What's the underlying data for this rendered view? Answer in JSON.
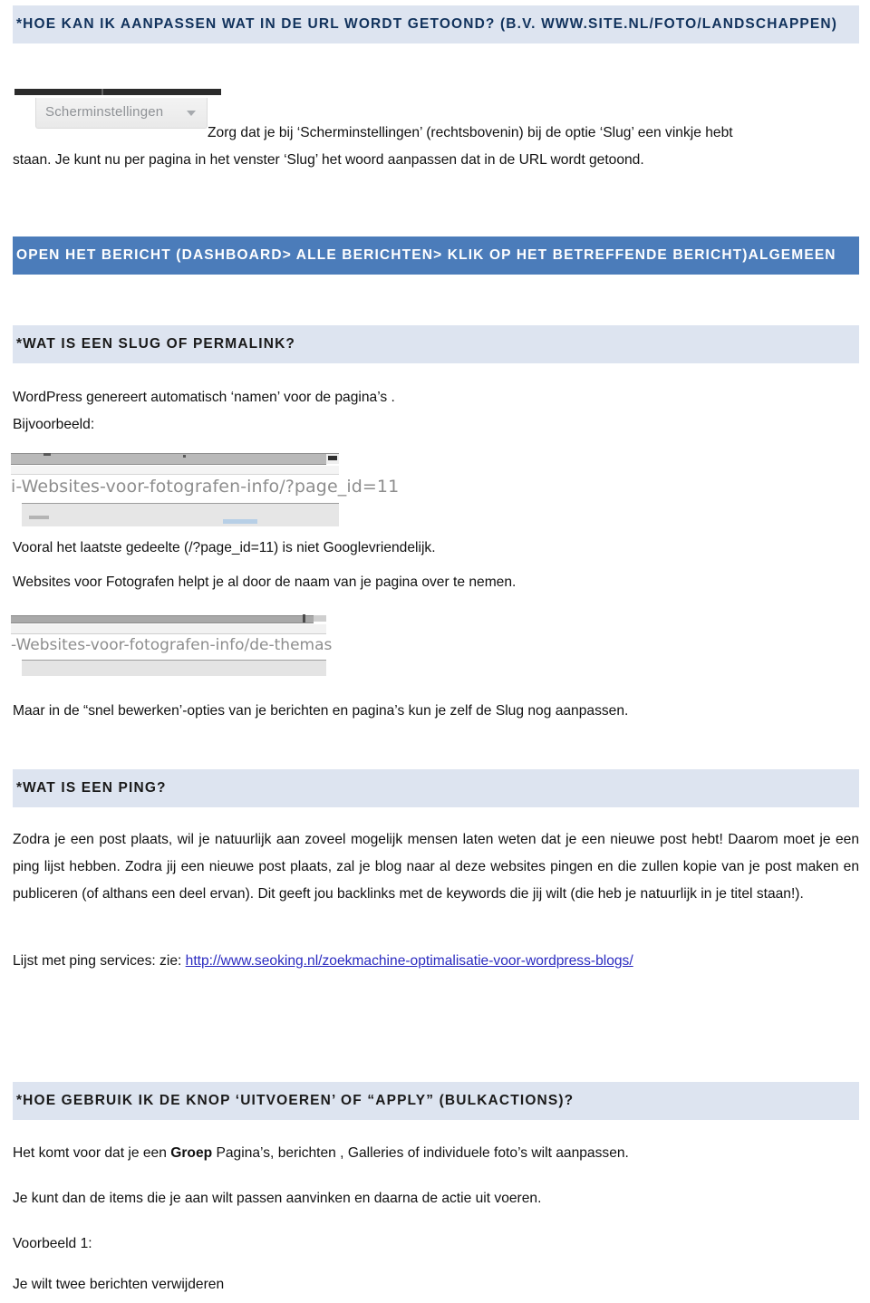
{
  "document": {
    "language": "nl",
    "colors": {
      "band_light": "#dde4f0",
      "band_blue": "#4b7cba",
      "link": "#2a2ac0",
      "text": "#111111"
    }
  },
  "sections": [
    {
      "id": "url-aanpassen",
      "heading": "*HOE KAN IK AANPASSEN WAT IN DE URL WORDT GETOOND? (B.V. WWW.SITE.NL/FOTO/LANDSCHAPPEN)",
      "style": "light"
    },
    {
      "id": "open-het-bericht",
      "heading": "OPEN HET BERICHT (DASHBOARD> ALLE BERICHTEN> KLIK OP HET BETREFFENDE BERICHT)ALGEMEEN",
      "style": "blue"
    },
    {
      "id": "wat-is-een-slug",
      "heading": "*WAT IS EEN SLUG OF PERMALINK?",
      "style": "light"
    },
    {
      "id": "wat-is-een-ping",
      "heading": "*WAT IS EEN PING?",
      "style": "light"
    },
    {
      "id": "knop-uitvoeren",
      "heading": "*HOE GEBRUIK IK DE KNOP ‘UITVOEREN’ OF “APPLY” (BULKACTIONS)?",
      "style": "light"
    }
  ],
  "body": {
    "scherm_intro_line1": "Zorg dat je bij ‘Scherminstellingen’ (rechtsbovenin) bij de optie ‘Slug’ een vinkje hebt",
    "scherm_intro_line2": "staan. Je kunt nu per pagina in het venster ‘Slug’ het woord aanpassen dat in de URL wordt getoond.",
    "wordpress_namen": "WordPress genereert automatisch ‘namen’ voor de pagina’s .",
    "bijvoorbeeld": "Bijvoorbeeld:",
    "vooral_laatste": "Vooral het laatste gedeelte (/?page_id=11)  is niet Googlevriendelijk.",
    "websites_helpt": "Websites voor Fotografen helpt je al door de naam van je pagina over te nemen.",
    "snel_bewerken": "Maar in de “snel bewerken’-opties van je berichten en pagina’s kun je zelf de Slug nog aanpassen.",
    "ping_paragraph": "Zodra je een post plaats, wil je natuurlijk aan zoveel mogelijk mensen laten weten dat je een nieuwe post hebt! Daarom moet je een ping lijst hebben. Zodra jij een nieuwe post plaats, zal je blog naar al deze websites pingen en die zullen kopie van je post maken en publiceren (of althans een deel ervan). Dit geeft jou backlinks met de keywords die jij wilt (die heb je natuurlijk in je titel staan!).",
    "ping_services_label": "Lijst met ping services: zie: ",
    "ping_services_url": "http://www.seoking.nl/zoekmachine-optimalisatie-voor-wordpress-blogs/",
    "bulk_intro_a": "Het komt voor dat je een ",
    "bulk_intro_bold": "Groep",
    "bulk_intro_b": " Pagina’s, berichten , Galleries of individuele foto’s wilt aanpassen.",
    "bulk_aanvinken": "Je kunt dan de items die je aan wilt passen aanvinken en daarna de actie uit voeren.",
    "voorbeeld_label": "Voorbeeld 1:",
    "voorbeeld_text": "Je wilt twee berichten verwijderen"
  },
  "screenshots": {
    "scherminstellingen": {
      "button_label": "Scherminstellingen",
      "caret": "chevron-down-icon"
    },
    "url_bar_1": {
      "url_text": "i-Websites-voor-fotografen-info/?page_id=11"
    },
    "url_bar_2": {
      "url_text": "-Websites-voor-fotografen-info/de-themas"
    }
  }
}
